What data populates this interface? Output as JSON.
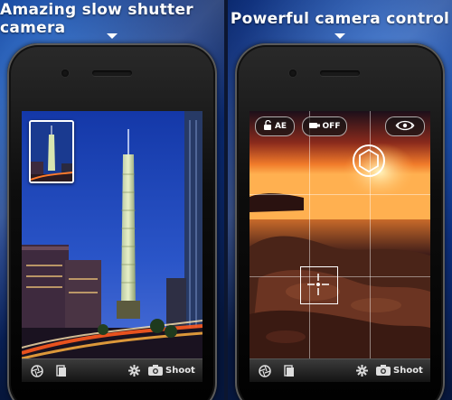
{
  "left_panel": {
    "title": "Amazing slow shutter camera"
  },
  "right_panel": {
    "title": "Powerful camera control",
    "controls": {
      "ae_label": "AE",
      "flash_label": "OFF"
    }
  },
  "toolbar": {
    "shoot_label": "Shoot"
  },
  "icons": [
    "aperture-icon",
    "gallery-icon",
    "settings-icon",
    "camera-icon",
    "lock-open-icon",
    "flash-icon",
    "eye-swap-icon",
    "exposure-target-icon",
    "focus-target-icon"
  ]
}
